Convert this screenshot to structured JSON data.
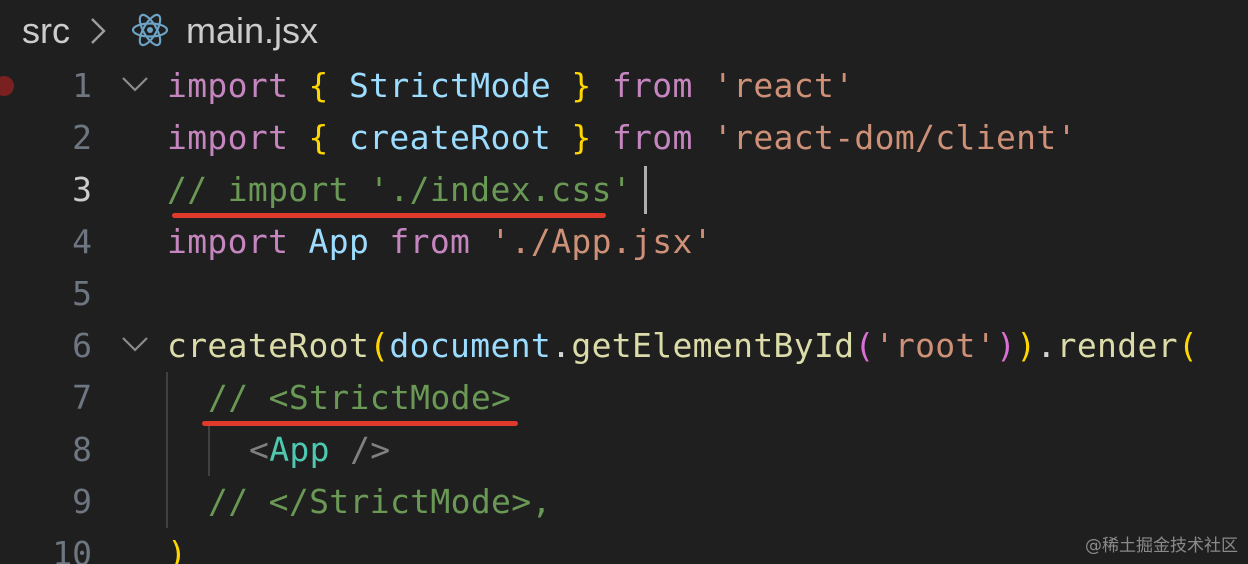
{
  "breadcrumb": {
    "folder": "src",
    "file": "main.jsx",
    "file_icon": "react-icon"
  },
  "colors": {
    "background": "#1f1f1f",
    "keyword": "#c586c0",
    "identifier": "#9cdcfe",
    "function": "#dcdcaa",
    "string": "#ce9178",
    "comment": "#6a9955",
    "bracket": "#ffd700",
    "annotation": "#e03a2c"
  },
  "editor": {
    "active_line": 3,
    "lines": [
      {
        "number": "1",
        "tokens": [
          "import",
          "{",
          "StrictMode",
          "}",
          "from",
          "'react'"
        ]
      },
      {
        "number": "2",
        "tokens": [
          "import",
          "{",
          "createRoot",
          "}",
          "from",
          "'react-dom/client'"
        ]
      },
      {
        "number": "3",
        "tokens": [
          "// import './index.css'"
        ]
      },
      {
        "number": "4",
        "tokens": [
          "import",
          "App",
          "from",
          "'./App.jsx'"
        ]
      },
      {
        "number": "5",
        "tokens": []
      },
      {
        "number": "6",
        "tokens": [
          "createRoot",
          "(",
          "document",
          ".",
          "getElementById",
          "(",
          "'root'",
          ")",
          ")",
          ".",
          "render",
          "("
        ]
      },
      {
        "number": "7",
        "tokens": [
          "// <StrictMode>"
        ]
      },
      {
        "number": "8",
        "tokens": [
          "<",
          "App",
          " />"
        ]
      },
      {
        "number": "9",
        "tokens": [
          "// </StrictMode>,"
        ]
      },
      {
        "number": "10",
        "tokens": [
          ")"
        ]
      }
    ]
  },
  "watermark": "@稀土掘金技术社区"
}
